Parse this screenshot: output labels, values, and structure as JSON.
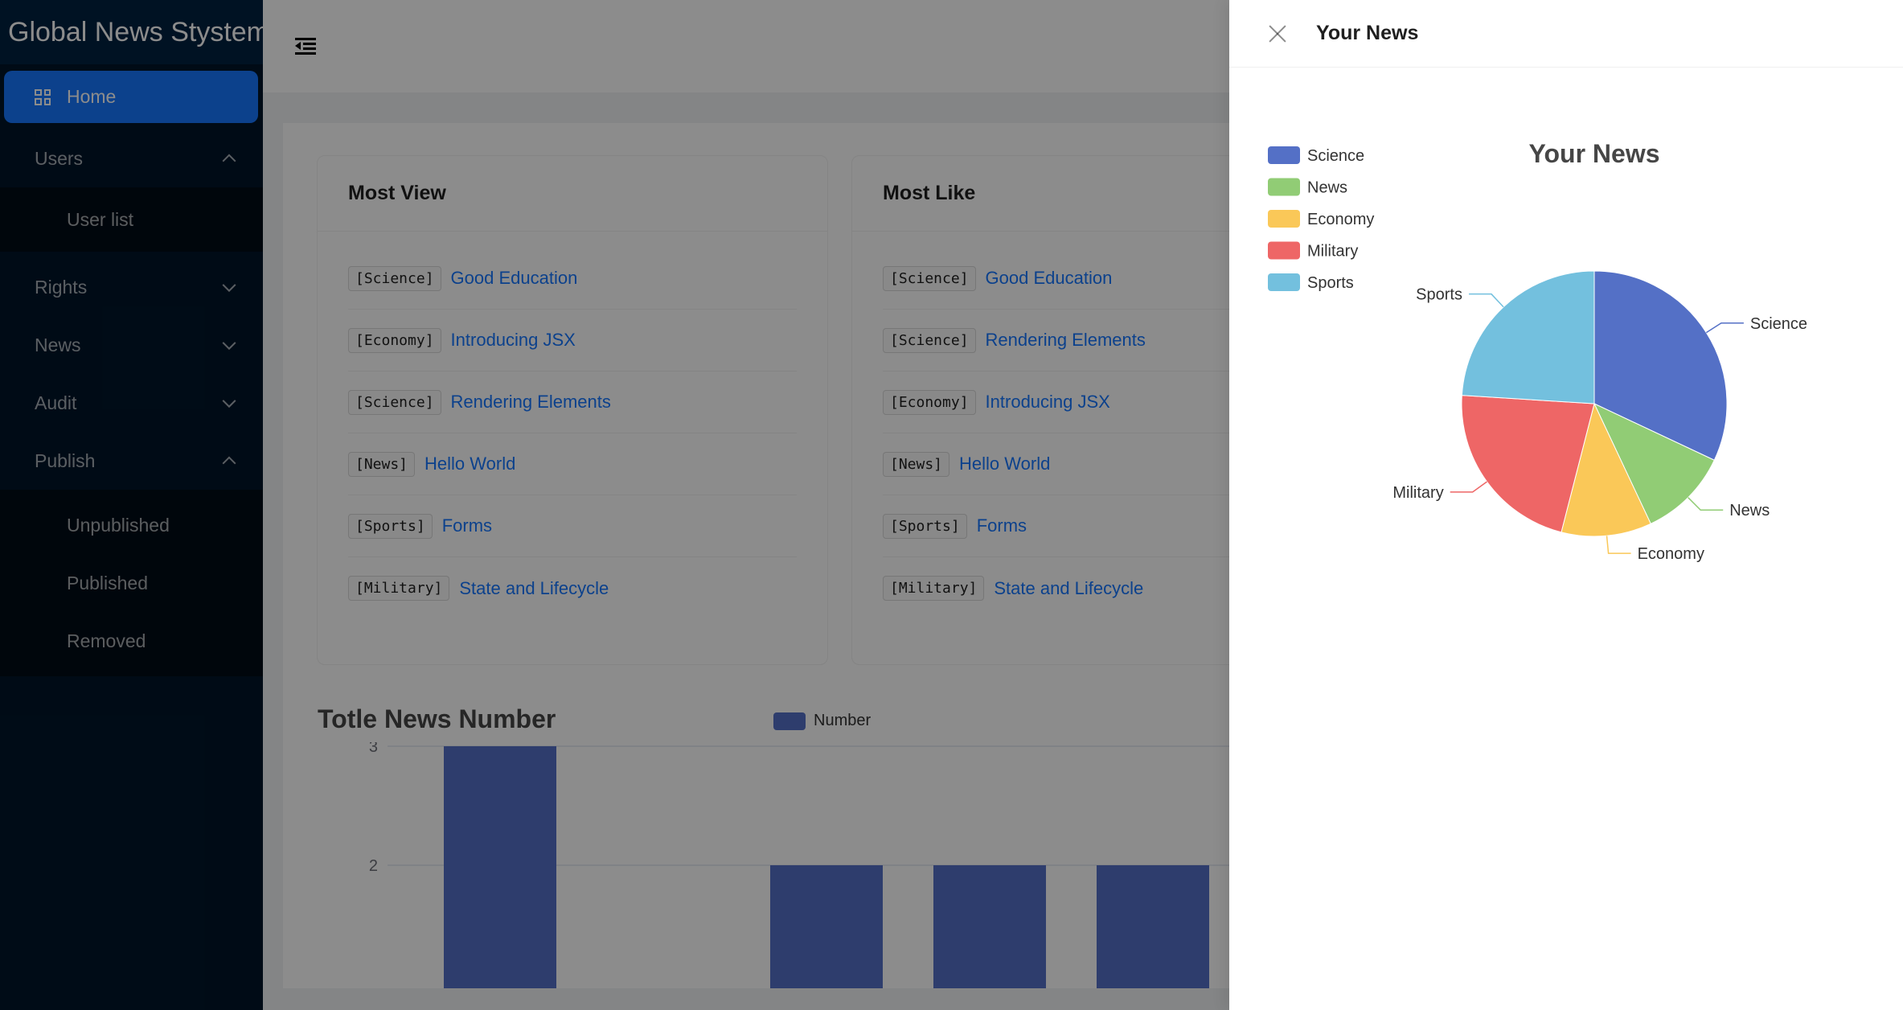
{
  "sidebar": {
    "logo": "Global News Stystem",
    "items": [
      {
        "label": "Home"
      },
      {
        "label": "Users"
      },
      {
        "label": "User list"
      },
      {
        "label": "Rights"
      },
      {
        "label": "News"
      },
      {
        "label": "Audit"
      },
      {
        "label": "Publish"
      },
      {
        "label": "Unpublished"
      },
      {
        "label": "Published"
      },
      {
        "label": "Removed"
      }
    ]
  },
  "header": {
    "collapse_icon": "menu-fold-icon"
  },
  "most_view": {
    "title": "Most View",
    "rows": [
      {
        "tag": "[Science]",
        "title": "Good Education"
      },
      {
        "tag": "[Economy]",
        "title": "Introducing JSX"
      },
      {
        "tag": "[Science]",
        "title": "Rendering Elements"
      },
      {
        "tag": "[News]",
        "title": "Hello World"
      },
      {
        "tag": "[Sports]",
        "title": "Forms"
      },
      {
        "tag": "[Military]",
        "title": "State and Lifecycle"
      }
    ]
  },
  "most_like": {
    "title": "Most Like",
    "rows": [
      {
        "tag": "[Science]",
        "title": "Good Education"
      },
      {
        "tag": "[Science]",
        "title": "Rendering Elements"
      },
      {
        "tag": "[Economy]",
        "title": "Introducing JSX"
      },
      {
        "tag": "[News]",
        "title": "Hello World"
      },
      {
        "tag": "[Sports]",
        "title": "Forms"
      },
      {
        "tag": "[Military]",
        "title": "State and Lifecycle"
      }
    ]
  },
  "drawer": {
    "title": "Your News"
  },
  "chart_data": [
    {
      "type": "bar",
      "title": "Totle News Number",
      "series": [
        {
          "name": "Number",
          "values": [
            3,
            0,
            2,
            2,
            2
          ]
        }
      ],
      "ytick_labels": [
        "2",
        "3"
      ],
      "ylim": [
        0,
        3
      ],
      "grid": true,
      "legend": "top-center",
      "color": "#5470c6"
    },
    {
      "type": "pie",
      "title": "Your News",
      "categories": [
        "Science",
        "News",
        "Economy",
        "Military",
        "Sports"
      ],
      "values": [
        32,
        11,
        11,
        22,
        24
      ],
      "colors": [
        "#5470c6",
        "#91cc75",
        "#fac858",
        "#ee6666",
        "#73c0de"
      ],
      "legend": "top-left"
    }
  ]
}
